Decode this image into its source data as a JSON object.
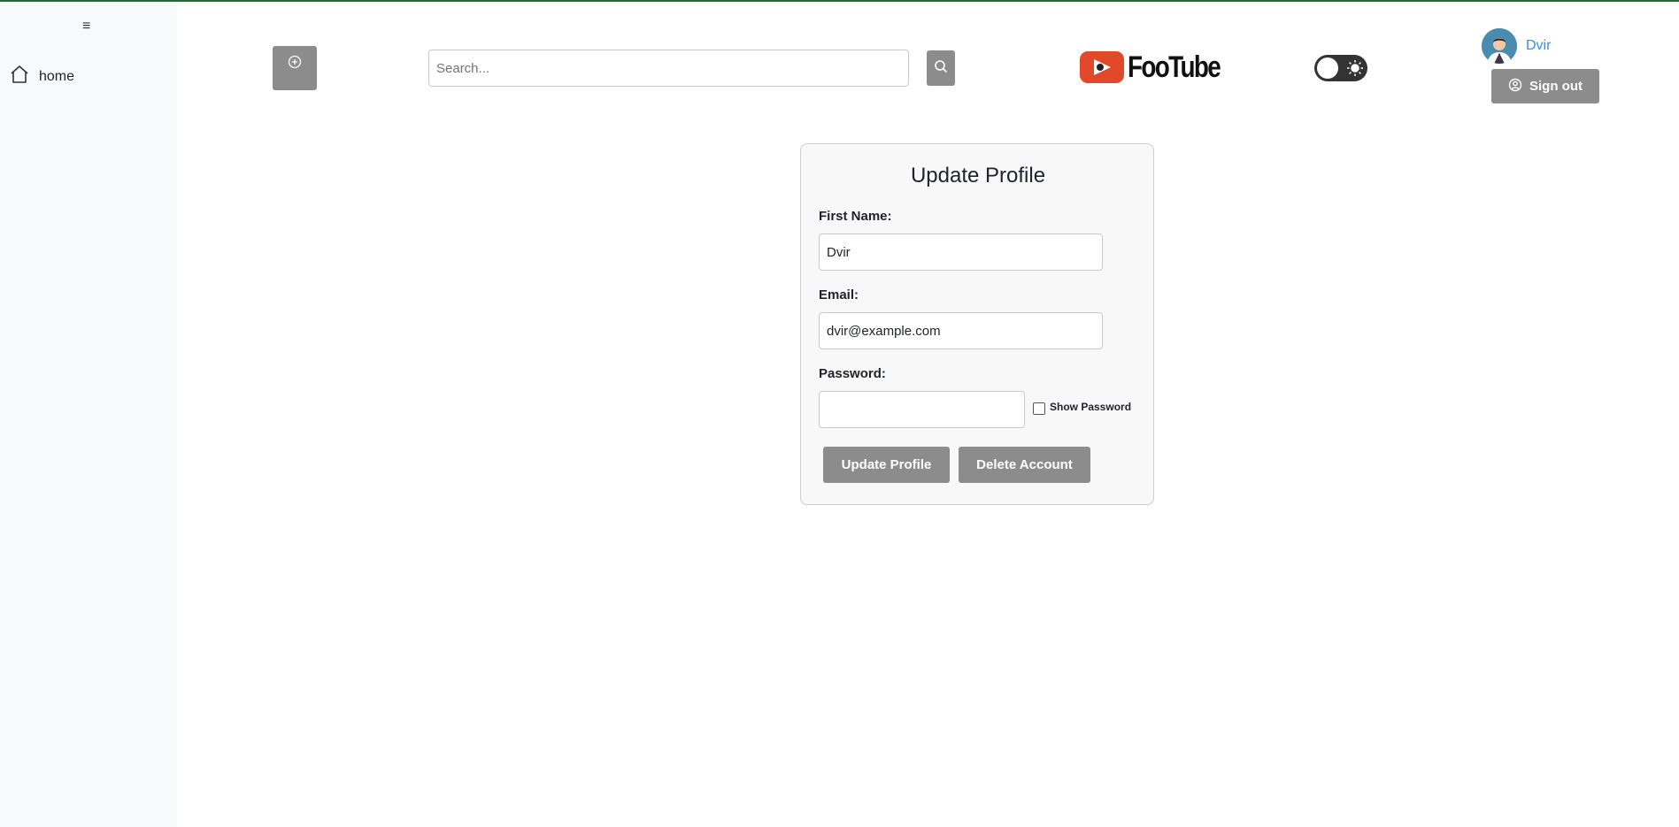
{
  "sidebar": {
    "menu_icon": "≡",
    "items": [
      {
        "label": "home",
        "icon": "home-icon"
      }
    ]
  },
  "header": {
    "upload_icon": "plus-circle-icon",
    "search": {
      "placeholder": "Search...",
      "value": ""
    },
    "search_icon": "search-icon",
    "logo_text": "FooTube",
    "theme_toggle_icon": "sun-icon",
    "user": {
      "name": "Dvir"
    },
    "signout_label": "Sign out"
  },
  "form": {
    "title": "Update Profile",
    "first_name_label": "First Name:",
    "first_name_value": "Dvir",
    "email_label": "Email:",
    "email_value": "dvir@example.com",
    "password_label": "Password:",
    "password_value": "",
    "show_password_label": "Show Password",
    "update_button": "Update Profile",
    "delete_button": "Delete Account"
  },
  "colors": {
    "accent_green": "#1e6b35",
    "button_gray": "#8c8c8c",
    "logo_red": "#e2492a",
    "user_link": "#3a8fd6"
  }
}
